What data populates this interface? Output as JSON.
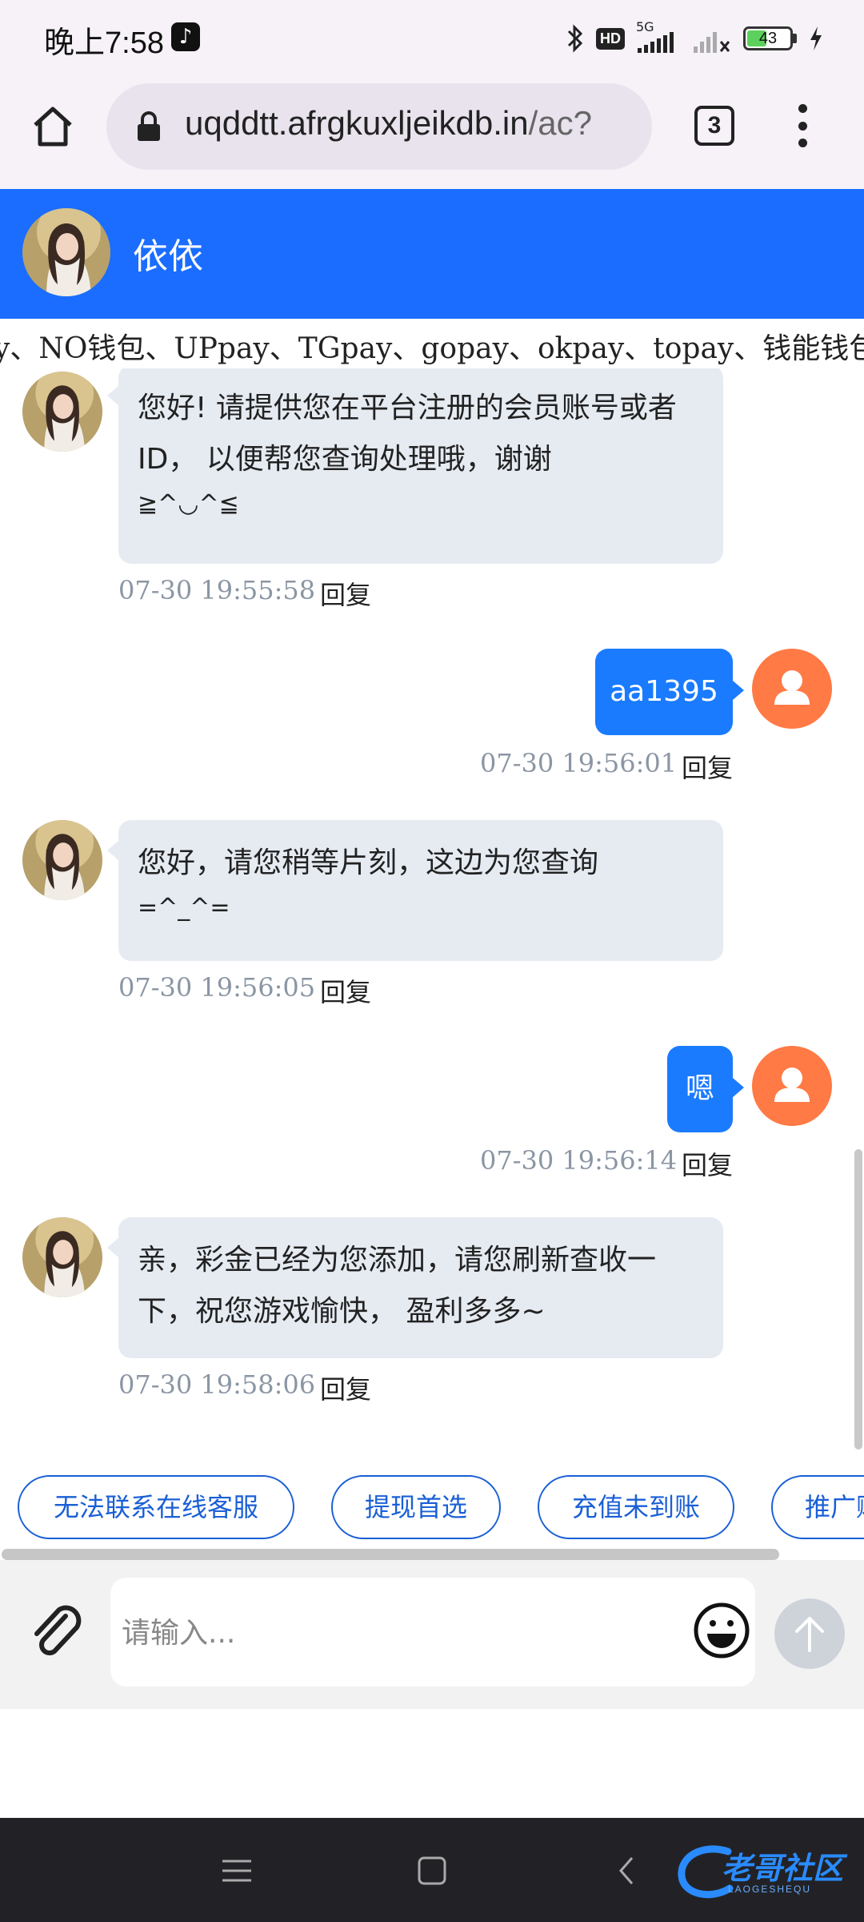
{
  "status_bar": {
    "time": "晚上7:58",
    "network": "5G",
    "hd_label": "HD",
    "battery": "43",
    "battery_level": 0.43
  },
  "browser": {
    "url_main": "uqddtt.afrgkuxljeikdb.in",
    "url_rest": "/ac?",
    "tab_count": "3"
  },
  "chat_header": {
    "title": "依依"
  },
  "marquee": {
    "text": "y、NO钱包、UPpay、TGpay、gopay、okpay、topay、钱能钱包、"
  },
  "messages": [
    {
      "sender": "agent",
      "text": "您好! 请提供您在平台注册的会员账号或者 ID， 以便帮您查询处理哦，谢谢",
      "emoticon": "≧^◡^≦",
      "time": "07-30 19:55:58",
      "reply": "回复"
    },
    {
      "sender": "user",
      "text": "aa1395",
      "time": "07-30 19:56:01",
      "reply": "回复"
    },
    {
      "sender": "agent",
      "text": "您好，请您稍等片刻，这边为您查询",
      "emoticon": "=^_^=",
      "time": "07-30 19:56:05",
      "reply": "回复"
    },
    {
      "sender": "user",
      "text": "嗯",
      "time": "07-30 19:56:14",
      "reply": "回复"
    },
    {
      "sender": "agent",
      "text": "亲，彩金已经为您添加，请您刷新查收一下，祝您游戏愉快， 盈利多多~",
      "time": "07-30 19:58:06",
      "reply": "回复"
    }
  ],
  "quick_replies": [
    "无法联系在线客服",
    "提现首选",
    "充值未到账",
    "推广赚"
  ],
  "input": {
    "placeholder": "请输入..."
  },
  "watermark": {
    "text": "老哥社区",
    "sub": "LAOGESHEQU"
  },
  "colors": {
    "header_blue": "#1a6dff",
    "user_bubble": "#1a7bff",
    "agent_bubble": "#e6ebf2",
    "user_avatar": "#ff7a45",
    "quick_border": "#1a5fd6"
  }
}
